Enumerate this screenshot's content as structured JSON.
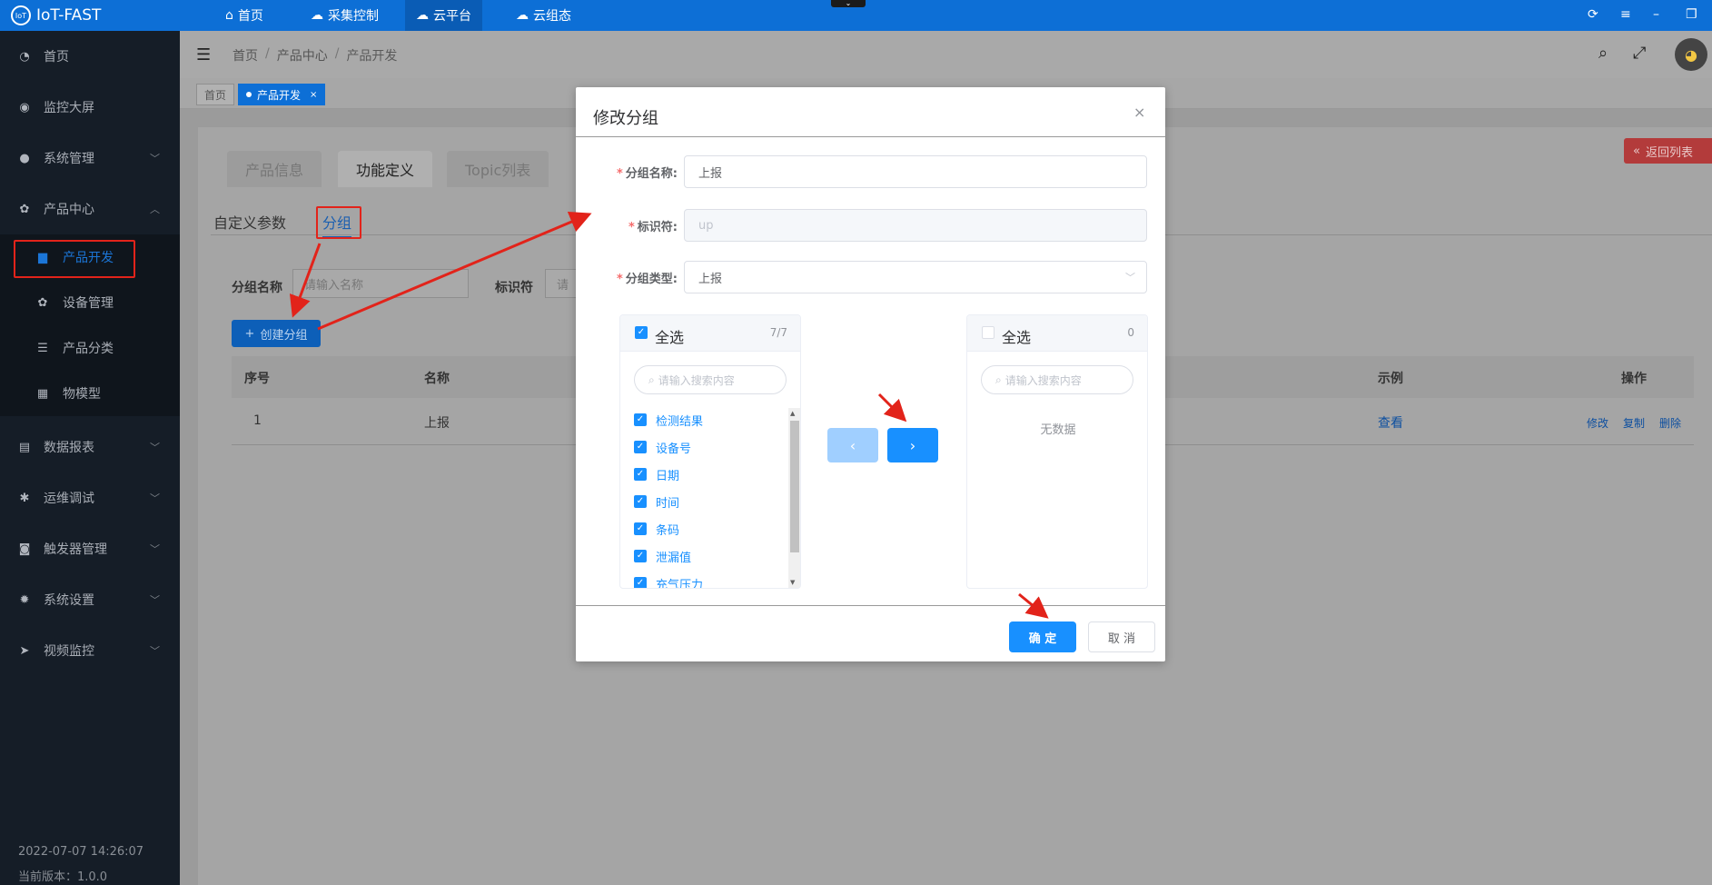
{
  "app": {
    "title": "IoT-FAST"
  },
  "topnav": [
    {
      "label": "首页",
      "icon": "home-icon"
    },
    {
      "label": "采集控制",
      "icon": "cloud-gear-icon"
    },
    {
      "label": "云平台",
      "icon": "cloud-icon"
    },
    {
      "label": "云组态",
      "icon": "cloud-config-icon"
    }
  ],
  "sidebar": {
    "items": [
      {
        "label": "首页"
      },
      {
        "label": "监控大屏"
      },
      {
        "label": "系统管理"
      },
      {
        "label": "产品中心"
      },
      {
        "label": "数据报表"
      },
      {
        "label": "运维调试"
      },
      {
        "label": "触发器管理"
      },
      {
        "label": "系统设置"
      },
      {
        "label": "视频监控"
      }
    ],
    "sub": [
      {
        "label": "产品开发"
      },
      {
        "label": "设备管理"
      },
      {
        "label": "产品分类"
      },
      {
        "label": "物模型"
      }
    ],
    "footer_time": "2022-07-07 14:26:07",
    "footer_version": "当前版本：1.0.0"
  },
  "breadcrumb": {
    "home": "首页",
    "level1": "产品中心",
    "level2": "产品开发",
    "sep": "/"
  },
  "tags": {
    "home": "首页",
    "current": "产品开发",
    "close": "×"
  },
  "tabs": [
    "产品信息",
    "功能定义",
    "Topic列表"
  ],
  "back_button": "返回列表",
  "subtabs": [
    "自定义参数",
    "分组"
  ],
  "filter": {
    "group_name_label": "分组名称",
    "group_name_placeholder": "请输入名称",
    "identifier_label": "标识符",
    "identifier_placeholder": "请"
  },
  "create_button": "创建分组",
  "table": {
    "headers": {
      "index": "序号",
      "name": "名称",
      "example": "示例",
      "action": "操作"
    },
    "rows": [
      {
        "index": "1",
        "name": "上报",
        "view": "查看",
        "edit": "修改",
        "copy": "复制",
        "delete": "删除"
      }
    ]
  },
  "modal": {
    "title": "修改分组",
    "close": "×",
    "group_name_label": "分组名称:",
    "group_name_value": "上报",
    "identifier_label": "标识符:",
    "identifier_value": "up",
    "group_type_label": "分组类型:",
    "group_type_value": "上报",
    "required_mark": "*",
    "left_panel": {
      "title": "全选",
      "count": "7/7",
      "search_placeholder": "请输入搜索内容",
      "items": [
        "检测结果",
        "设备号",
        "日期",
        "时间",
        "条码",
        "泄漏值",
        "充气压力"
      ]
    },
    "right_panel": {
      "title": "全选",
      "count": "0",
      "search_placeholder": "请输入搜索内容",
      "empty": "无数据"
    },
    "ok": "确 定",
    "cancel": "取 消"
  },
  "colors": {
    "primary": "#1890ff",
    "topbar": "#0d6fd6",
    "sidebar": "#151d27",
    "annotation": "#e2231a"
  }
}
